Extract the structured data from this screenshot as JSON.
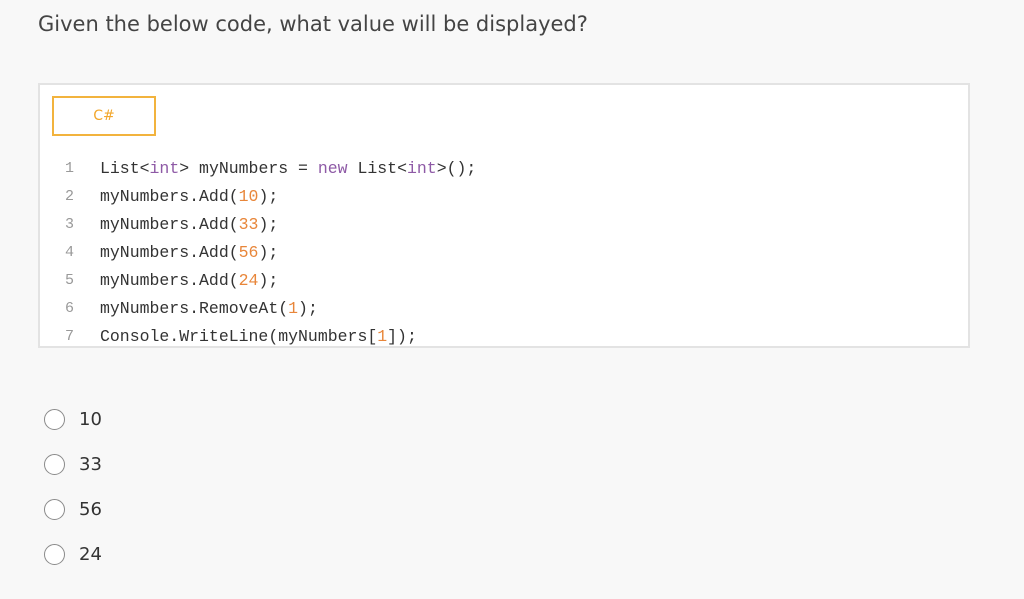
{
  "question": "Given the below code, what value will be displayed?",
  "code_block": {
    "language": "C#",
    "lines": [
      {
        "num": "1",
        "tokens": [
          {
            "t": "List<",
            "c": "plain"
          },
          {
            "t": "int",
            "c": "kw"
          },
          {
            "t": "> myNumbers = ",
            "c": "plain"
          },
          {
            "t": "new",
            "c": "kw"
          },
          {
            "t": " List<",
            "c": "plain"
          },
          {
            "t": "int",
            "c": "kw"
          },
          {
            "t": ">();",
            "c": "plain"
          }
        ]
      },
      {
        "num": "2",
        "tokens": [
          {
            "t": "myNumbers.Add(",
            "c": "plain"
          },
          {
            "t": "10",
            "c": "num"
          },
          {
            "t": ");",
            "c": "plain"
          }
        ]
      },
      {
        "num": "3",
        "tokens": [
          {
            "t": "myNumbers.Add(",
            "c": "plain"
          },
          {
            "t": "33",
            "c": "num"
          },
          {
            "t": ");",
            "c": "plain"
          }
        ]
      },
      {
        "num": "4",
        "tokens": [
          {
            "t": "myNumbers.Add(",
            "c": "plain"
          },
          {
            "t": "56",
            "c": "num"
          },
          {
            "t": ");",
            "c": "plain"
          }
        ]
      },
      {
        "num": "5",
        "tokens": [
          {
            "t": "myNumbers.Add(",
            "c": "plain"
          },
          {
            "t": "24",
            "c": "num"
          },
          {
            "t": ");",
            "c": "plain"
          }
        ]
      },
      {
        "num": "6",
        "tokens": [
          {
            "t": "myNumbers.RemoveAt(",
            "c": "plain"
          },
          {
            "t": "1",
            "c": "num"
          },
          {
            "t": ");",
            "c": "plain"
          }
        ]
      },
      {
        "num": "7",
        "tokens": [
          {
            "t": "Console.WriteLine(myNumbers[",
            "c": "plain"
          },
          {
            "t": "1",
            "c": "num"
          },
          {
            "t": "]);",
            "c": "plain"
          }
        ]
      }
    ]
  },
  "answers": [
    {
      "label": "10",
      "selected": false
    },
    {
      "label": "33",
      "selected": false
    },
    {
      "label": "56",
      "selected": false
    },
    {
      "label": "24",
      "selected": false
    }
  ],
  "colors": {
    "accent": "#f2b33d",
    "keyword": "#8e5aa6",
    "number": "#e8863a"
  }
}
